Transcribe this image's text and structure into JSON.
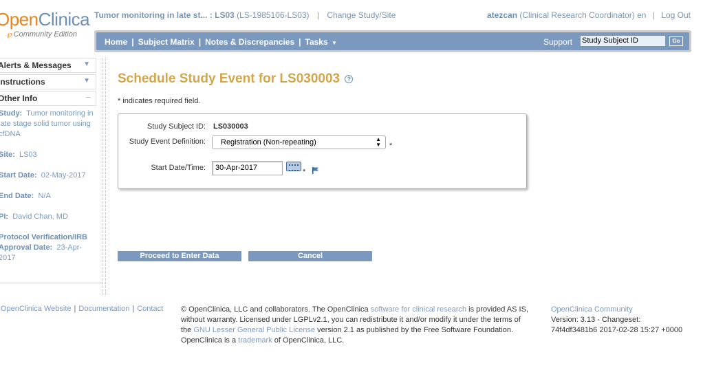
{
  "logo": {
    "part1": "Open",
    "part2": "Clinica",
    "edition": "Community Edition"
  },
  "header": {
    "study_short": "Tumor monitoring in late st... : LS03",
    "study_ids": "(LS-1985106-LS03)",
    "change_study": "Change Study/Site",
    "username": "atezcan",
    "role": "(Clinical Research Coordinator)",
    "lang": "en",
    "logout": "Log Out"
  },
  "nav": {
    "home": "Home",
    "subject_matrix": "Subject Matrix",
    "notes": "Notes & Discrepancies",
    "tasks": "Tasks",
    "support": "Support",
    "search_value": "Study Subject ID",
    "go": "Go"
  },
  "sidebar": {
    "alerts": "Alerts & Messages",
    "instructions": "Instructions",
    "other_info": "Other Info",
    "study_label": "Study:",
    "study_value": "Tumor monitoring in late stage solid tumor using cfDNA",
    "site_label": "Site:",
    "site_value": "LS03",
    "start_label": "Start Date:",
    "start_value": "02-May-2017",
    "end_label": "End Date:",
    "end_value": "N/A",
    "pi_label": "PI:",
    "pi_value": "David Chan, MD",
    "irb_label": "Protocol Verification/IRB Approval Date:",
    "irb_value": "23-Apr-2017"
  },
  "main": {
    "title": "Schedule Study Event for LS030003",
    "required_note": "* indicates required field.",
    "subject_id_label": "Study Subject ID:",
    "subject_id_value": "LS030003",
    "event_def_label": "Study Event Definition:",
    "event_def_value": "Registration (Non-repeating)",
    "start_date_label": "Start Date/Time:",
    "start_date_value": "30-Apr-2017",
    "star": "*",
    "proceed": "Proceed to Enter Data",
    "cancel": "Cancel"
  },
  "footer": {
    "website": "OpenClinica Website",
    "docs": "Documentation",
    "contact": "Contact",
    "t1": "© OpenClinica, LLC and collaborators. The OpenClinica ",
    "t1_link": "software for clinical research",
    "t2": " is provided AS IS, without warranty. Licensed under LGPLv2.1, you can redistribute it and/or modify it under the terms of the ",
    "t2_link": "GNU Lesser General Public License",
    "t3": " version 2.1 as published by the Free Software Foundation. OpenClinica is a ",
    "t3_link": "trademark",
    "t4": " of OpenClinica, LLC.",
    "community": "OpenClinica Community",
    "version": "Version: 3.13 - Changeset:",
    "changeset": "74f4df3481b6 2017-02-28 15:27 +0000"
  },
  "colors": {
    "accent": "#7b99be",
    "title": "#d4a64a",
    "logo_orange": "#e8841f"
  },
  "icons": [
    "help-icon",
    "calendar-icon",
    "flag-icon",
    "chevron-down-icon",
    "collapse-icon",
    "select-arrows-icon"
  ]
}
